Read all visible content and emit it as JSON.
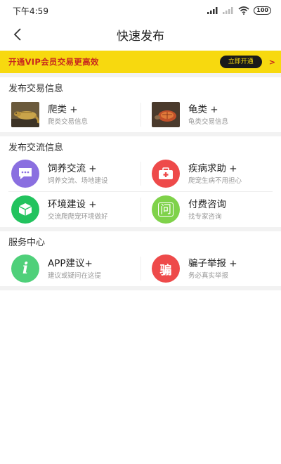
{
  "status": {
    "time": "下午4:59",
    "battery": "100"
  },
  "nav": {
    "title": "快速发布"
  },
  "vip": {
    "text": "开通VIP会员交易更高效",
    "button": "立即开通",
    "arrow": ">"
  },
  "sections": [
    {
      "title": "发布交易信息",
      "rows": [
        [
          {
            "title": "爬类 +",
            "sub": "爬类交易信息",
            "icon": "lizard-thumbnail"
          },
          {
            "title": "龟类 +",
            "sub": "龟类交易信息",
            "icon": "turtle-thumbnail"
          }
        ]
      ]
    },
    {
      "title": "发布交流信息",
      "rows": [
        [
          {
            "title": "饲养交流 +",
            "sub": "饲养交流、场地建设",
            "icon": "chat-icon",
            "color": "#8a6fe0"
          },
          {
            "title": "疾病求助 +",
            "sub": "爬宠生病不用担心",
            "icon": "medical-kit-icon",
            "color": "#ee4a4a"
          }
        ],
        [
          {
            "title": "环境建设 +",
            "sub": "交流爬爬宠环境做好",
            "icon": "cube-icon",
            "color": "#22c35e"
          },
          {
            "title": "付费咨询",
            "sub": "找专家咨询",
            "icon": "question-icon",
            "glyph": "问",
            "color": "#7fd24a"
          }
        ]
      ]
    },
    {
      "title": "服务中心",
      "rows": [
        [
          {
            "title": "APP建议+",
            "sub": "建议或疑问在这提",
            "icon": "info-icon",
            "glyph": "i",
            "color": "#4fd07a"
          },
          {
            "title": "骗子举报 +",
            "sub": "务必真实举报",
            "icon": "fraud-report-icon",
            "glyph": "骗",
            "color": "#ee4a4a"
          }
        ]
      ]
    }
  ]
}
